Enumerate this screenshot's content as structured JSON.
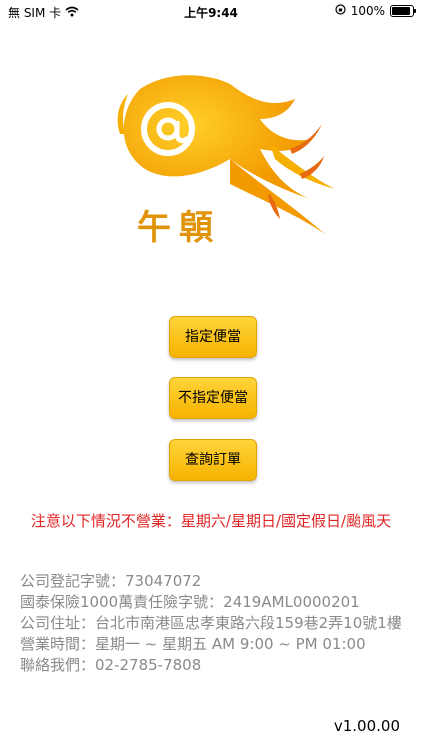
{
  "status_bar": {
    "carrier": "無 SIM 卡",
    "time": "上午9:44",
    "battery": "100%",
    "battery_level": 1.0
  },
  "logo": {
    "text": "午顊"
  },
  "buttons": {
    "designated": "指定便當",
    "not_designated": "不指定便當",
    "query_order": "查詢訂單"
  },
  "notice": "注意以下情況不營業：星期六/星期日/國定假日/颱風天",
  "company_info": {
    "registration": "公司登記字號：73047072",
    "insurance": "國泰保險1000萬責任險字號：2419AML0000201",
    "address": "公司住址：台北市南港區忠孝東路六段159巷2弄10號1樓",
    "hours": "營業時間：星期一 ~ 星期五 AM 9:00 ~ PM 01:00",
    "contact": "聯絡我們：02-2785-7808"
  },
  "version": "v1.00.00",
  "colors": {
    "accent": "#f6b300",
    "notice": "#e02525",
    "info": "#8a8a8a",
    "logo": "#e0940a"
  }
}
